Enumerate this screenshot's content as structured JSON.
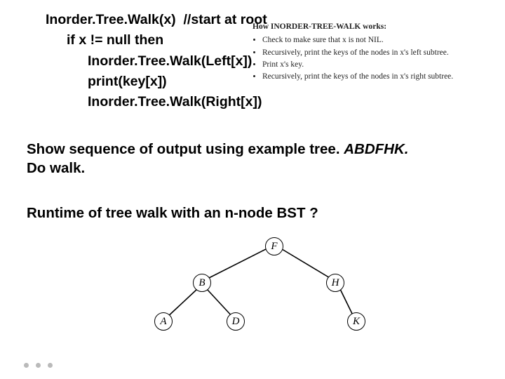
{
  "pseudo": {
    "line1a": "Inorder.Tree.Walk(x)",
    "line1b": "//start at root",
    "line2": "if x != null then",
    "line3": "Inorder.Tree.Walk(Left[x])",
    "line4": "print(key[x])",
    "line5": "Inorder.Tree.Walk(Right[x])"
  },
  "howbox": {
    "header": "How INORDER-TREE-WALK works:",
    "items": [
      "Check to make sure that x is not NIL.",
      "Recursively, print the keys of the nodes in x's left subtree.",
      "Print x's key.",
      "Recursively, print the keys of the nodes in x's right subtree."
    ]
  },
  "para1": {
    "lead": "Show sequence of output using example tree. ",
    "ital": "ABDFHK.",
    "trail": "Do walk."
  },
  "para2": "Runtime of tree walk with an n-node BST ?",
  "tree": {
    "F": "F",
    "B": "B",
    "H": "H",
    "A": "A",
    "D": "D",
    "K": "K"
  }
}
